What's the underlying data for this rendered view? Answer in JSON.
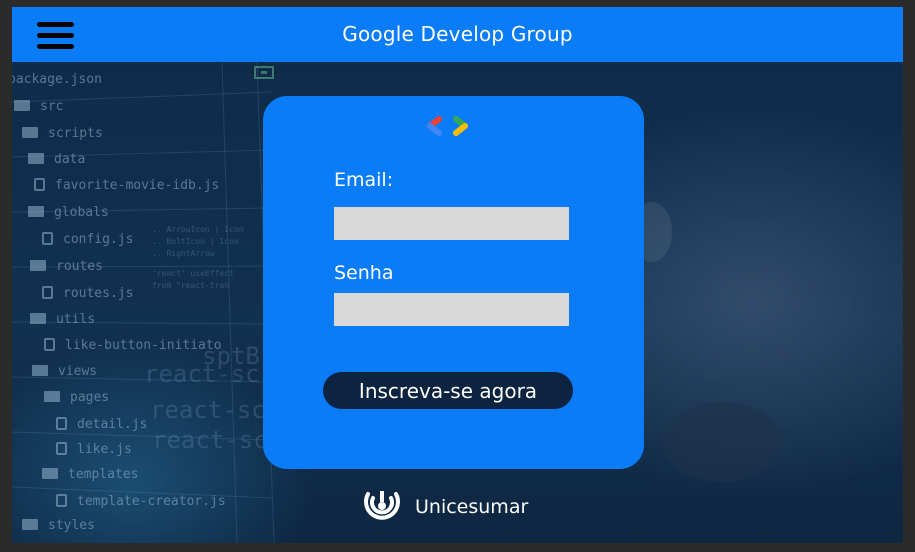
{
  "header": {
    "title": "Google Develop Group",
    "menu_icon": "hamburger-menu-icon"
  },
  "background": {
    "tree_items": [
      {
        "label": "package.json",
        "type": "text"
      },
      {
        "label": "src",
        "type": "folder"
      },
      {
        "label": "scripts",
        "type": "folder"
      },
      {
        "label": "data",
        "type": "folder"
      },
      {
        "label": "favorite-movie-idb.js",
        "type": "file"
      },
      {
        "label": "globals",
        "type": "folder"
      },
      {
        "label": "config.js",
        "type": "file"
      },
      {
        "label": "routes",
        "type": "folder"
      },
      {
        "label": "routes.js",
        "type": "file"
      },
      {
        "label": "utils",
        "type": "folder"
      },
      {
        "label": "like-button-initiato",
        "type": "file"
      },
      {
        "label": "views",
        "type": "folder"
      },
      {
        "label": "pages",
        "type": "folder"
      },
      {
        "label": "detail.js",
        "type": "file"
      },
      {
        "label": "like.js",
        "type": "file"
      },
      {
        "label": "templates",
        "type": "folder"
      },
      {
        "label": "template-creator.js",
        "type": "file"
      },
      {
        "label": "styles",
        "type": "folder"
      }
    ]
  },
  "login_card": {
    "logo_icon": "google-developers-logo-icon",
    "email_label": "Email:",
    "email_value": "",
    "password_label": "Senha",
    "password_value": "",
    "submit_label": "Inscreva-se agora"
  },
  "footer": {
    "brand_icon": "unicesumar-logo-icon",
    "brand_name": "Unicesumar"
  },
  "colors": {
    "primary": "#0a7cf7",
    "dark": "#0d2440",
    "input": "#d9d9d9"
  }
}
